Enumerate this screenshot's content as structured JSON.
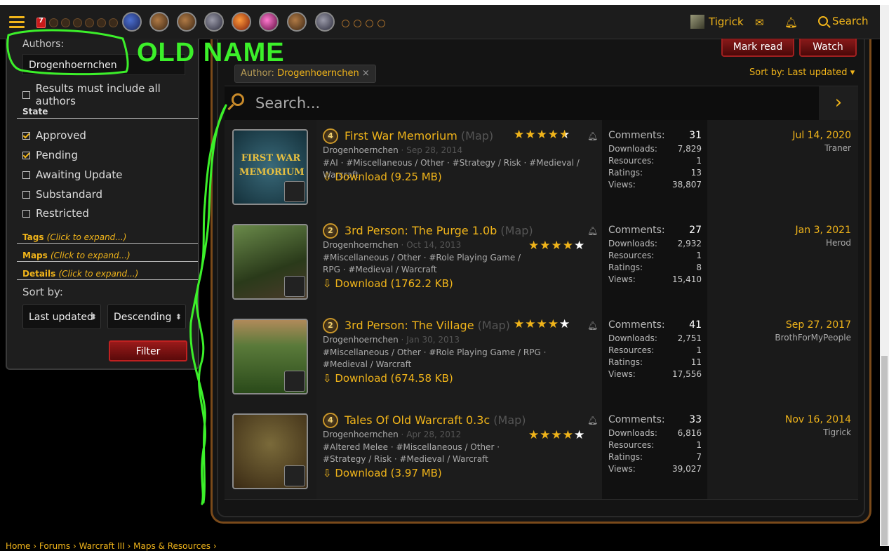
{
  "nav": {
    "user_name": "Tigrick",
    "search_label": "Search",
    "badge_count": "7",
    "icons": [
      "menu-icon",
      "mail-icon",
      "bell-icon",
      "search-icon"
    ]
  },
  "sidebar": {
    "authors_label": "Authors:",
    "authors_value": "Drogenhoernchen",
    "must_include": "Results must include all authors",
    "state_heading": "State",
    "states": [
      {
        "label": "Approved",
        "checked": true
      },
      {
        "label": "Pending",
        "checked": true
      },
      {
        "label": "Awaiting Update",
        "checked": false
      },
      {
        "label": "Substandard",
        "checked": false
      },
      {
        "label": "Restricted",
        "checked": false
      }
    ],
    "tags": {
      "label": "Tags",
      "hint": "(Click to expand...)"
    },
    "maps": {
      "label": "Maps",
      "hint": "(Click to expand...)"
    },
    "details": {
      "label": "Details",
      "hint": "(Click to expand...)"
    },
    "sort_label": "Sort by:",
    "sort_field": "Last updated",
    "sort_order": "Descending",
    "filter_button": "Filter"
  },
  "annotation": {
    "text": "OLD NAME",
    "color": "#3cf02a"
  },
  "main": {
    "mark_read": "Mark read",
    "watch": "Watch",
    "filter_chip_prefix": "Author:",
    "filter_chip_value": "Drogenhoernchen",
    "filter_chip_remove": "×",
    "sort_by": "Sort by: Last updated ▾",
    "search_placeholder": "Search...",
    "go_arrow": "›",
    "download_prefix": "Download"
  },
  "stat_labels": {
    "comments": "Comments:",
    "downloads": "Downloads:",
    "resources": "Resources:",
    "ratings": "Ratings:",
    "views": "Views:"
  },
  "resources": [
    {
      "level": "4",
      "title": "First War Memorium",
      "type": "(Map)",
      "rating": 4.5,
      "thumb_text": "FIRST WAR MEMORIUM",
      "author": "Drogenhoernchen",
      "created": "Sep 28, 2014",
      "tags": "#AI · #Miscellaneous / Other · #Strategy / Risk · #Medieval / Warcraft",
      "download": "Download (9.25 MB)",
      "comments": "31",
      "downloads": "7,829",
      "resources": "1",
      "ratings": "13",
      "views": "38,807",
      "updated": "Jul 14, 2020",
      "updated_by": "Traner"
    },
    {
      "level": "2",
      "title": "3rd Person: The Purge 1.0b",
      "type": "(Map)",
      "rating": 4,
      "author": "Drogenhoernchen",
      "created": "Oct 14, 2013",
      "tags": "#Miscellaneous / Other · #Role Playing Game / RPG · #Medieval / Warcraft",
      "download": "Download (1762.2 KB)",
      "comments": "27",
      "downloads": "2,932",
      "resources": "1",
      "ratings": "8",
      "views": "15,410",
      "updated": "Jan 3, 2021",
      "updated_by": "Herod"
    },
    {
      "level": "2",
      "title": "3rd Person: The Village",
      "type": "(Map)",
      "rating": 4,
      "author": "Drogenhoernchen",
      "created": "Jan 30, 2013",
      "tags": "#Miscellaneous / Other · #Role Playing Game / RPG · #Medieval / Warcraft",
      "download": "Download (674.58 KB)",
      "comments": "41",
      "downloads": "2,751",
      "resources": "1",
      "ratings": "11",
      "views": "17,556",
      "updated": "Sep 27, 2017",
      "updated_by": "BrothForMyPeople"
    },
    {
      "level": "4",
      "title": "Tales Of Old Warcraft 0.3c",
      "type": "(Map)",
      "rating": 4,
      "author": "Drogenhoernchen",
      "created": "Apr 28, 2012",
      "tags": "#Altered Melee · #Miscellaneous / Other · #Strategy / Risk · #Medieval / Warcraft",
      "download": "Download (3.97 MB)",
      "comments": "33",
      "downloads": "6,816",
      "resources": "1",
      "ratings": "7",
      "views": "39,027",
      "updated": "Nov 16, 2014",
      "updated_by": "Tigrick"
    }
  ],
  "breadcrumb": "Home › Forums › Warcraft III › Maps & Resources ›"
}
